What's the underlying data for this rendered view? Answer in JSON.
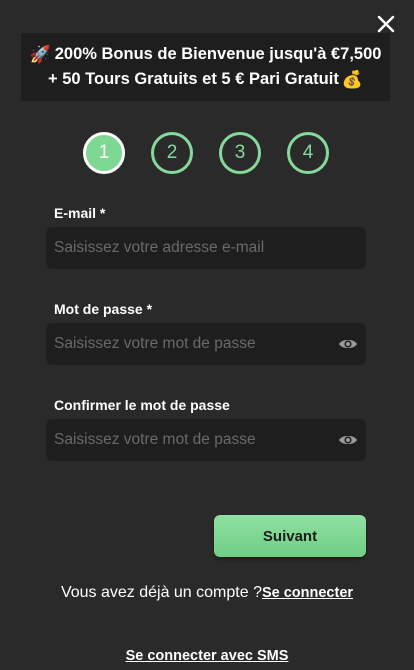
{
  "banner": {
    "icon_start": "🚀",
    "line1": "200% Bonus de Bienvenue jusqu'à €7,500",
    "line2": "+ 50 Tours Gratuits et 5 € Pari Gratuit",
    "icon_end": "💰"
  },
  "steps": [
    {
      "label": "1",
      "active": true
    },
    {
      "label": "2",
      "active": false
    },
    {
      "label": "3",
      "active": false
    },
    {
      "label": "4",
      "active": false
    }
  ],
  "form": {
    "email": {
      "label": "E-mail *",
      "placeholder": "Saisissez votre adresse e-mail",
      "value": ""
    },
    "password": {
      "label": "Mot de passe *",
      "placeholder": "Saisissez votre mot de passe",
      "value": ""
    },
    "confirm_password": {
      "label": "Confirmer le mot de passe",
      "placeholder": "Saisissez votre mot de passe",
      "value": ""
    }
  },
  "next_button_label": "Suivant",
  "login_prompt": {
    "text": "Vous avez déjà un compte ?",
    "link": "Se connecter"
  },
  "sms_login_link": "Se connecter avec SMS",
  "colors": {
    "background": "#2a2a2a",
    "field_background": "#1e1e1e",
    "accent_green": "#7dd893",
    "placeholder": "#6a6a6a"
  },
  "icons": {
    "close": "close-icon",
    "eye": "eye-icon",
    "rocket": "rocket-icon",
    "money_bag": "money-bag-icon"
  }
}
